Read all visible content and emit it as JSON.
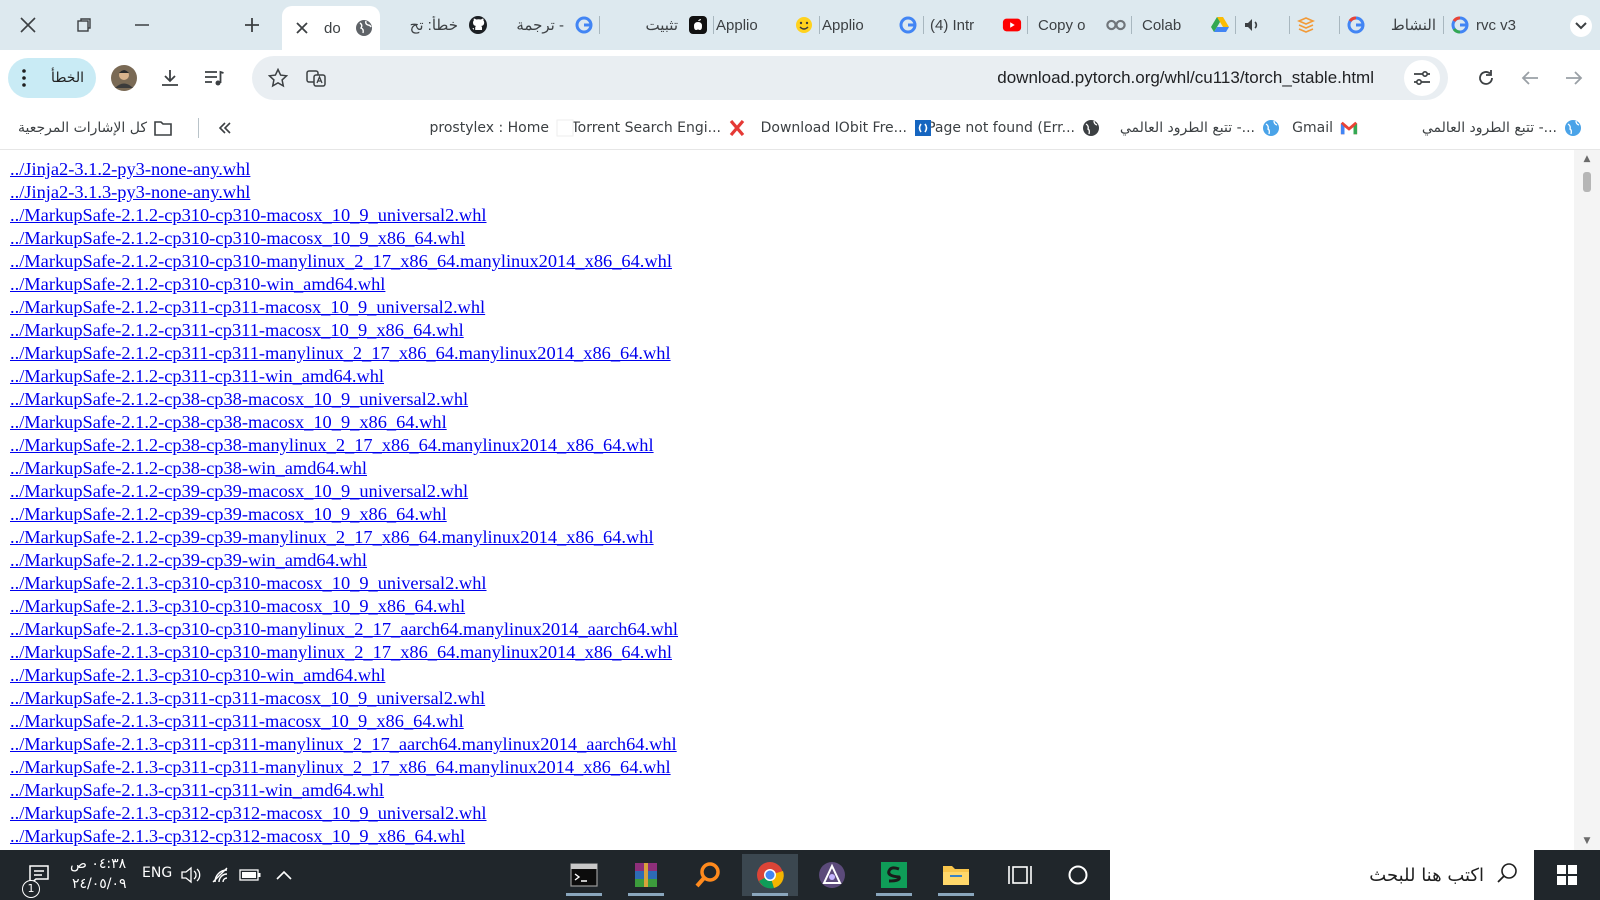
{
  "tabs": [
    {
      "title": "rvc v3",
      "favicon": "google-icon"
    },
    {
      "title": "النشاط",
      "favicon": "google-icon"
    },
    {
      "title": "",
      "favicon": "stack-icon"
    },
    {
      "title": "",
      "favicon": "audio-playing-icon"
    },
    {
      "title": "Colab",
      "favicon": "drive-icon"
    },
    {
      "title": "Copy o",
      "favicon": "colab-icon"
    },
    {
      "title": "(4) Intr",
      "favicon": "youtube-icon"
    },
    {
      "title": "Applio",
      "favicon": "google-icon"
    },
    {
      "title": "Applio",
      "favicon": "huggingface-icon"
    },
    {
      "title": "تثبيت",
      "favicon": "apple-icon"
    },
    {
      "title": "ترجمة -",
      "favicon": "google-icon"
    },
    {
      "title": "خطأ: تح",
      "favicon": "github-icon"
    },
    {
      "title": "do",
      "favicon": "globe-icon",
      "active": true
    }
  ],
  "toolbar": {
    "url": "download.pytorch.org/whl/cu113/torch_stable.html",
    "profile_label": "الخطأ"
  },
  "bookmarks": [
    {
      "label": "تتبع الطرود العالمي -...",
      "icon": "globe-blue-icon"
    },
    {
      "label": "Gmail",
      "icon": "gmail-icon"
    },
    {
      "label": "تتبع الطرود العالمي -...",
      "icon": "globe-blue-icon"
    },
    {
      "label": "Page not found (Err...",
      "icon": "globe-dark-icon"
    },
    {
      "label": "Download IObit Fre...",
      "icon": "iobit-icon"
    },
    {
      "label": "Torrent Search Engi...",
      "icon": "torrent-x-icon"
    },
    {
      "label": "prostylex : Home",
      "icon": "blank-icon"
    }
  ],
  "all_bookmarks_label": "كل الإشارات المرجعية",
  "links": [
    "../Jinja2-3.1.2-py3-none-any.whl",
    "../Jinja2-3.1.3-py3-none-any.whl",
    "../MarkupSafe-2.1.2-cp310-cp310-macosx_10_9_universal2.whl",
    "../MarkupSafe-2.1.2-cp310-cp310-macosx_10_9_x86_64.whl",
    "../MarkupSafe-2.1.2-cp310-cp310-manylinux_2_17_x86_64.manylinux2014_x86_64.whl",
    "../MarkupSafe-2.1.2-cp310-cp310-win_amd64.whl",
    "../MarkupSafe-2.1.2-cp311-cp311-macosx_10_9_universal2.whl",
    "../MarkupSafe-2.1.2-cp311-cp311-macosx_10_9_x86_64.whl",
    "../MarkupSafe-2.1.2-cp311-cp311-manylinux_2_17_x86_64.manylinux2014_x86_64.whl",
    "../MarkupSafe-2.1.2-cp311-cp311-win_amd64.whl",
    "../MarkupSafe-2.1.2-cp38-cp38-macosx_10_9_universal2.whl",
    "../MarkupSafe-2.1.2-cp38-cp38-macosx_10_9_x86_64.whl",
    "../MarkupSafe-2.1.2-cp38-cp38-manylinux_2_17_x86_64.manylinux2014_x86_64.whl",
    "../MarkupSafe-2.1.2-cp38-cp38-win_amd64.whl",
    "../MarkupSafe-2.1.2-cp39-cp39-macosx_10_9_universal2.whl",
    "../MarkupSafe-2.1.2-cp39-cp39-macosx_10_9_x86_64.whl",
    "../MarkupSafe-2.1.2-cp39-cp39-manylinux_2_17_x86_64.manylinux2014_x86_64.whl",
    "../MarkupSafe-2.1.2-cp39-cp39-win_amd64.whl",
    "../MarkupSafe-2.1.3-cp310-cp310-macosx_10_9_universal2.whl",
    "../MarkupSafe-2.1.3-cp310-cp310-macosx_10_9_x86_64.whl",
    "../MarkupSafe-2.1.3-cp310-cp310-manylinux_2_17_aarch64.manylinux2014_aarch64.whl",
    "../MarkupSafe-2.1.3-cp310-cp310-manylinux_2_17_x86_64.manylinux2014_x86_64.whl",
    "../MarkupSafe-2.1.3-cp310-cp310-win_amd64.whl",
    "../MarkupSafe-2.1.3-cp311-cp311-macosx_10_9_universal2.whl",
    "../MarkupSafe-2.1.3-cp311-cp311-macosx_10_9_x86_64.whl",
    "../MarkupSafe-2.1.3-cp311-cp311-manylinux_2_17_aarch64.manylinux2014_aarch64.whl",
    "../MarkupSafe-2.1.3-cp311-cp311-manylinux_2_17_x86_64.manylinux2014_x86_64.whl",
    "../MarkupSafe-2.1.3-cp311-cp311-win_amd64.whl",
    "../MarkupSafe-2.1.3-cp312-cp312-macosx_10_9_universal2.whl",
    "../MarkupSafe-2.1.3-cp312-cp312-macosx_10_9_x86_64.whl"
  ],
  "taskbar": {
    "search_placeholder": "اكتب هنا للبحث",
    "apps": [
      "terminal-icon",
      "winrar-icon",
      "search-magnifier-app-icon",
      "chrome-icon",
      "affinity-icon",
      "sublime-icon",
      "file-explorer-icon",
      "task-view-icon",
      "cortana-icon"
    ],
    "time": "٠٤:٣٨ ص",
    "date": "٢٤/٠٥/٠٩",
    "language": "ENG",
    "notification_count": "1"
  },
  "colors": {
    "tabstrip_bg": "#dde9ef",
    "link": "#0000ee",
    "taskbar_bg": "#20262b",
    "profile_pill": "#c9ebf5"
  }
}
